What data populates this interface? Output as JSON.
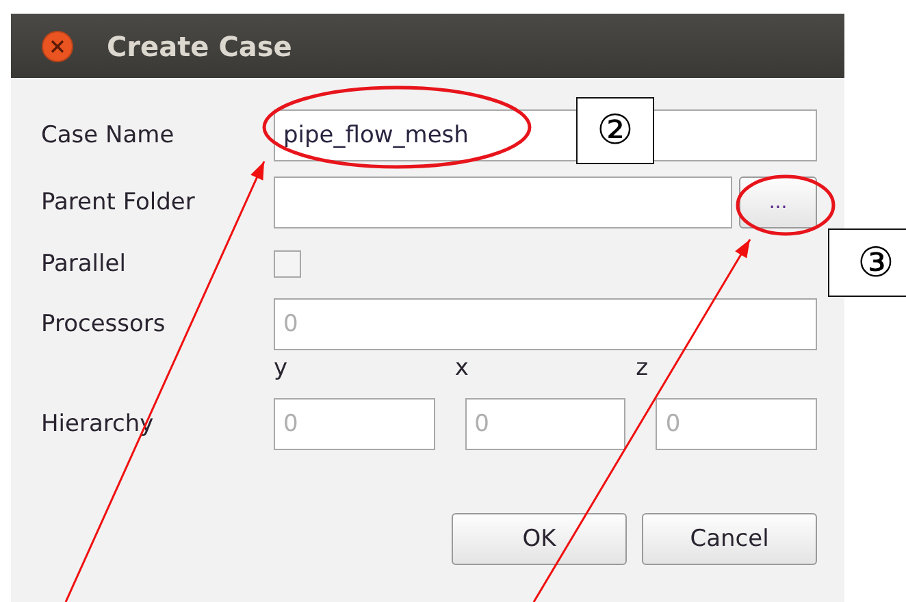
{
  "window": {
    "title": "Create Case"
  },
  "fields": [
    {
      "label": "Case Name",
      "kind": "text",
      "value": "pipe_flow_mesh"
    },
    {
      "label": "Parent Folder",
      "kind": "browse",
      "button": "..."
    },
    {
      "label": "Parallel",
      "kind": "checkbox",
      "checked": false
    },
    {
      "label": "Processors",
      "kind": "text",
      "placeholder": "0"
    }
  ],
  "hierarchy": {
    "label": "Hierarchy",
    "axes": [
      {
        "axis": "y",
        "placeholder": "0"
      },
      {
        "axis": "x",
        "placeholder": "0"
      },
      {
        "axis": "z",
        "placeholder": "0"
      }
    ]
  },
  "buttons": [
    "OK",
    "Cancel"
  ],
  "annotations": [
    {
      "number": "②"
    },
    {
      "number": "③"
    }
  ]
}
